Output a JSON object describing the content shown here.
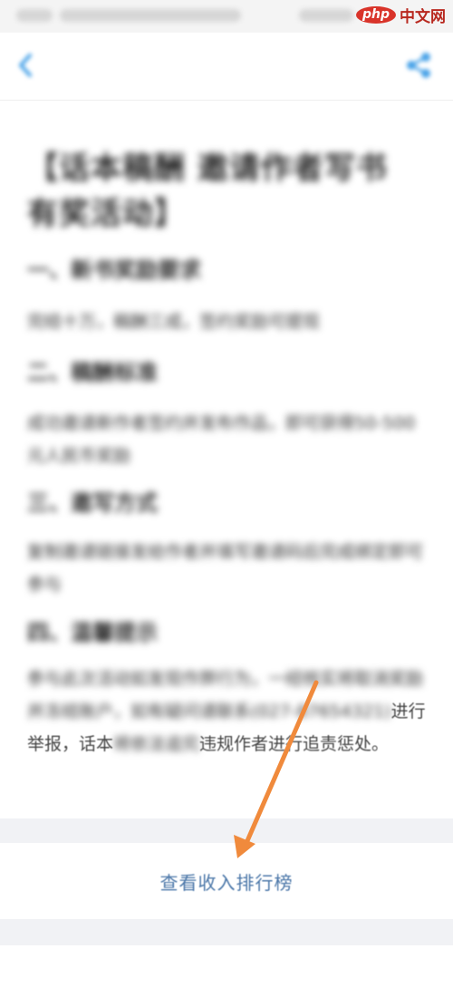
{
  "watermark": {
    "php": "php",
    "site": "中文网"
  },
  "nav": {
    "back_icon": "chevron-left-icon",
    "share_icon": "share-icon"
  },
  "article": {
    "title": "【话本稿酬 邀请作者写书 有奖活动】",
    "sections": [
      {
        "heading": "一、新书奖励要求",
        "body": "完结十万，稿酬三成，签约奖励可提现"
      },
      {
        "heading": "二、稿酬标准",
        "body": "成功邀请新作者签约并发布作品，即可获得50-500元人民币奖励"
      },
      {
        "heading": "三、邀写方式",
        "body": "复制邀请链接发给作者并填写邀请码后完成绑定即可参与"
      },
      {
        "heading": "四、温馨提示",
        "body": ""
      }
    ],
    "notice_blurred_start": "参与此次活动如发现作弊行为，一经核实将取消奖励并冻结账户，如有疑问请联系(027-87654321)",
    "notice_clear_a": "进行举报，话本",
    "notice_blurred_mid": "将依法追究",
    "notice_clear_b": "违规作者进行追责惩处。"
  },
  "footer": {
    "ranking_link": "查看收入排行榜"
  },
  "colors": {
    "link": "#4a76a8",
    "annotation_arrow": "#f08a3c",
    "band": "#f1f2f5",
    "nav_icon": "#4aa3e8"
  }
}
